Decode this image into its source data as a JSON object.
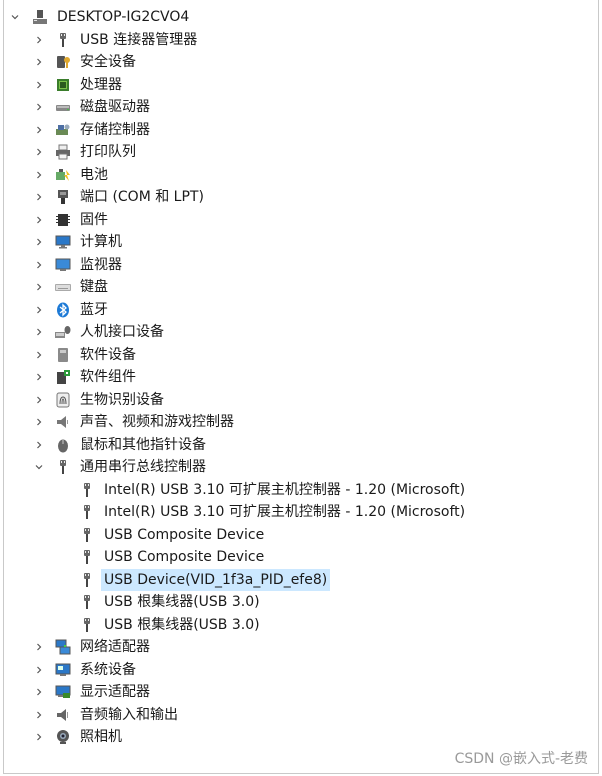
{
  "root": {
    "label": "DESKTOP-IG2CVO4",
    "icon": "computer-icon",
    "expanded": true
  },
  "categories": [
    {
      "label": "USB 连接器管理器",
      "icon": "usb-plug-icon"
    },
    {
      "label": "安全设备",
      "icon": "security-key-icon"
    },
    {
      "label": "处理器",
      "icon": "cpu-icon"
    },
    {
      "label": "磁盘驱动器",
      "icon": "disk-drive-icon"
    },
    {
      "label": "存储控制器",
      "icon": "storage-controller-icon"
    },
    {
      "label": "打印队列",
      "icon": "printer-icon"
    },
    {
      "label": "电池",
      "icon": "battery-icon"
    },
    {
      "label": "端口 (COM 和 LPT)",
      "icon": "port-icon"
    },
    {
      "label": "固件",
      "icon": "firmware-icon"
    },
    {
      "label": "计算机",
      "icon": "monitor-icon"
    },
    {
      "label": "监视器",
      "icon": "display-icon"
    },
    {
      "label": "键盘",
      "icon": "keyboard-icon"
    },
    {
      "label": "蓝牙",
      "icon": "bluetooth-icon"
    },
    {
      "label": "人机接口设备",
      "icon": "hid-icon"
    },
    {
      "label": "软件设备",
      "icon": "software-device-icon"
    },
    {
      "label": "软件组件",
      "icon": "software-component-icon"
    },
    {
      "label": "生物识别设备",
      "icon": "fingerprint-icon"
    },
    {
      "label": "声音、视频和游戏控制器",
      "icon": "speaker-icon"
    },
    {
      "label": "鼠标和其他指针设备",
      "icon": "mouse-icon"
    },
    {
      "label": "通用串行总线控制器",
      "icon": "usb-plug-icon",
      "expanded": true,
      "children": [
        {
          "label": "Intel(R) USB 3.10 可扩展主机控制器 - 1.20 (Microsoft)",
          "icon": "usb-plug-icon"
        },
        {
          "label": "Intel(R) USB 3.10 可扩展主机控制器 - 1.20 (Microsoft)",
          "icon": "usb-plug-icon"
        },
        {
          "label": "USB Composite Device",
          "icon": "usb-plug-icon"
        },
        {
          "label": "USB Composite Device",
          "icon": "usb-plug-icon"
        },
        {
          "label": "USB Device(VID_1f3a_PID_efe8)",
          "icon": "usb-plug-icon",
          "selected": true
        },
        {
          "label": "USB 根集线器(USB 3.0)",
          "icon": "usb-plug-icon"
        },
        {
          "label": "USB 根集线器(USB 3.0)",
          "icon": "usb-plug-icon"
        }
      ]
    },
    {
      "label": "网络适配器",
      "icon": "network-icon"
    },
    {
      "label": "系统设备",
      "icon": "system-device-icon"
    },
    {
      "label": "显示适配器",
      "icon": "display-adapter-icon"
    },
    {
      "label": "音频输入和输出",
      "icon": "audio-icon"
    },
    {
      "label": "照相机",
      "icon": "camera-icon"
    }
  ],
  "watermark": "CSDN @嵌入式-老费",
  "colors": {
    "selection": "#cce8ff",
    "chevron": "#555555"
  }
}
